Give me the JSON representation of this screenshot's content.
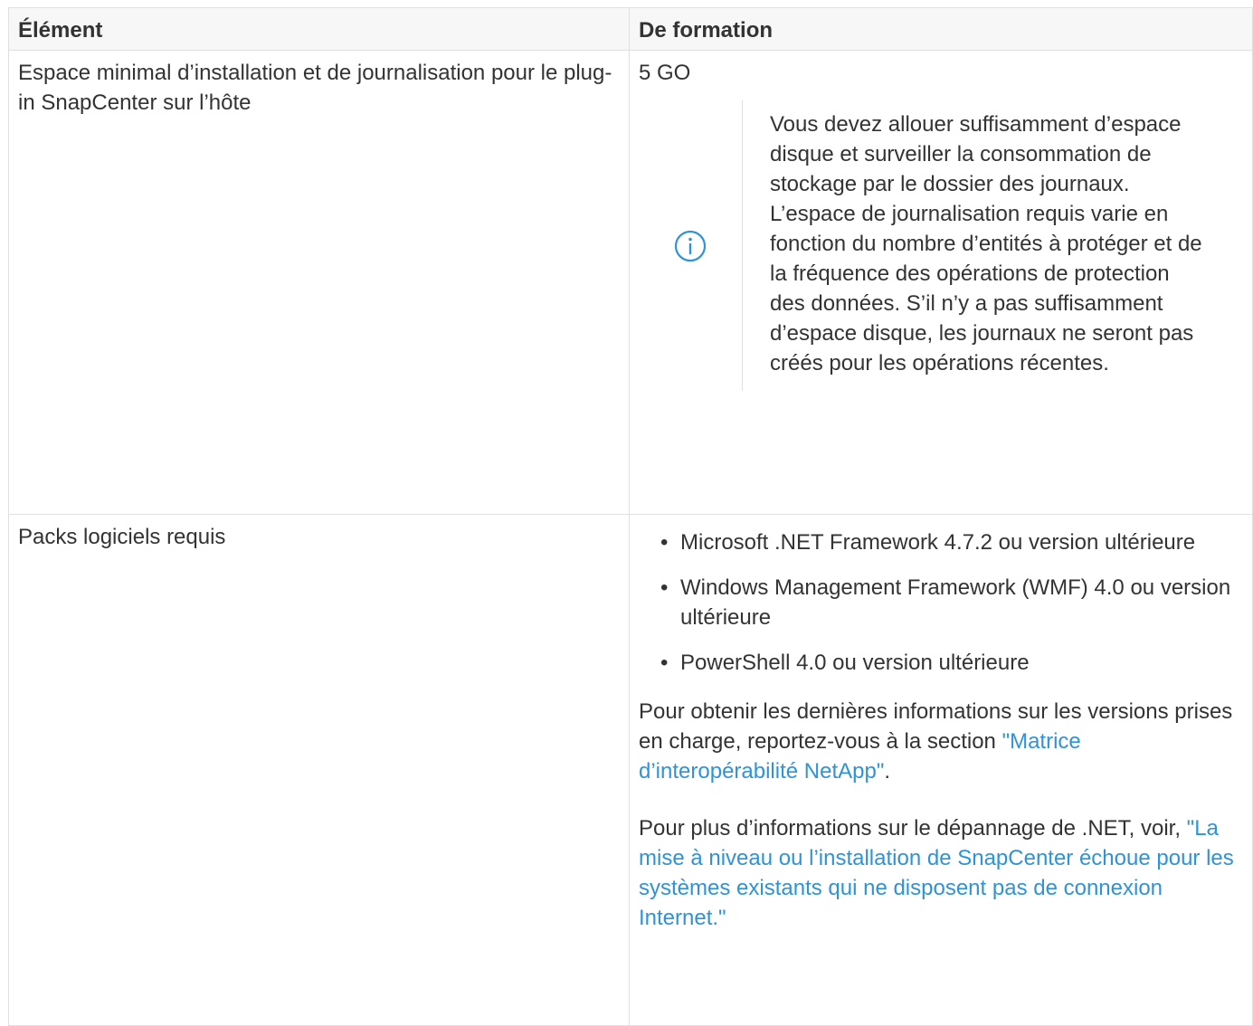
{
  "table": {
    "headers": [
      "Élément",
      "De formation"
    ],
    "rows": [
      {
        "element": "Espace minimal d’installation et de journalisation pour le plug-in SnapCenter sur l’hôte",
        "value": "5 GO",
        "note": {
          "icon": "info-icon",
          "text": "Vous devez allouer suffisamment d’espace disque et surveiller la consommation de stockage par le dossier des journaux. L’espace de journalisation requis varie en fonction du nombre d’entités à protéger et de la fréquence des opérations de protection des données. S’il n’y a pas suffisamment d’espace disque, les journaux ne seront pas créés pour les opérations récentes."
        }
      },
      {
        "element": "Packs logiciels requis",
        "packages": [
          "Microsoft .NET Framework 4.7.2 ou version ultérieure",
          "Windows Management Framework (WMF) 4.0 ou version ultérieure",
          "PowerShell 4.0 ou version ultérieure"
        ],
        "para1": {
          "text": "Pour obtenir les dernières informations sur les versions prises en charge, reportez-vous à la section ",
          "link": "\"Matrice d’interopérabilité NetApp\"",
          "suffix": "."
        },
        "para2": {
          "text": "Pour plus d’informations sur le dépannage de .NET, voir, ",
          "link": "\"La mise à niveau ou l’installation de SnapCenter échoue pour les systèmes existants qui ne disposent pas de connexion Internet.\""
        }
      }
    ]
  },
  "colors": {
    "link": "#2f93d7",
    "info_icon": "#2f93d7",
    "text": "#333333",
    "border": "#e0e0e0",
    "header_bg": "#f7f7f7"
  }
}
